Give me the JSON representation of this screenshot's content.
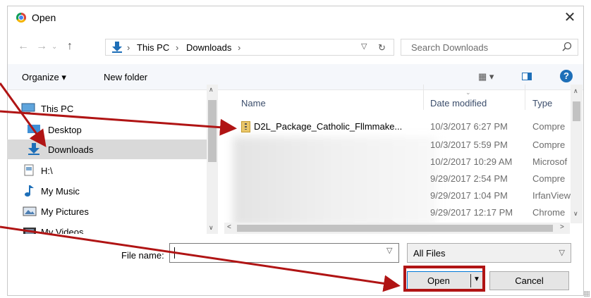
{
  "window": {
    "title": "Open",
    "close_glyph": "✕"
  },
  "address": {
    "crumbs": [
      "This PC",
      "Downloads"
    ],
    "separator": "›",
    "search_placeholder": "Search Downloads"
  },
  "toolbar": {
    "organize": "Organize ▾",
    "new_folder": "New folder",
    "views_glyph": "▦ ▾",
    "help": "?"
  },
  "nav": {
    "items": [
      {
        "label": "This PC"
      },
      {
        "label": "Desktop"
      },
      {
        "label": "Downloads",
        "selected": true
      },
      {
        "label": "H:\\"
      },
      {
        "label": "My Music"
      },
      {
        "label": "My Pictures"
      },
      {
        "label": "My Videos"
      }
    ]
  },
  "files": {
    "columns": [
      "Name",
      "Date modified",
      "Type"
    ],
    "rows": [
      {
        "name": "D2L_Package_Catholic_Fllmmake...",
        "date": "10/3/2017 6:27 PM",
        "type": "Compre"
      },
      {
        "name": "",
        "date": "10/3/2017 5:59 PM",
        "type": "Compre"
      },
      {
        "name": "",
        "date": "10/2/2017 10:29 AM",
        "type": "Microsof"
      },
      {
        "name": "",
        "date": "9/29/2017 2:54 PM",
        "type": "Compre"
      },
      {
        "name": "",
        "date": "9/29/2017 1:04 PM",
        "type": "IrfanView"
      },
      {
        "name": "",
        "date": "9/29/2017 12:17 PM",
        "type": "Chrome"
      }
    ]
  },
  "bottom": {
    "filename_label": "File name:",
    "filename_value": "",
    "filter_value": "All Files",
    "open_label": "Open",
    "cancel_label": "Cancel"
  },
  "colors": {
    "accent": "#1e6fb8",
    "annotation": "#b01414",
    "selected_bg": "#d9d9d9"
  }
}
